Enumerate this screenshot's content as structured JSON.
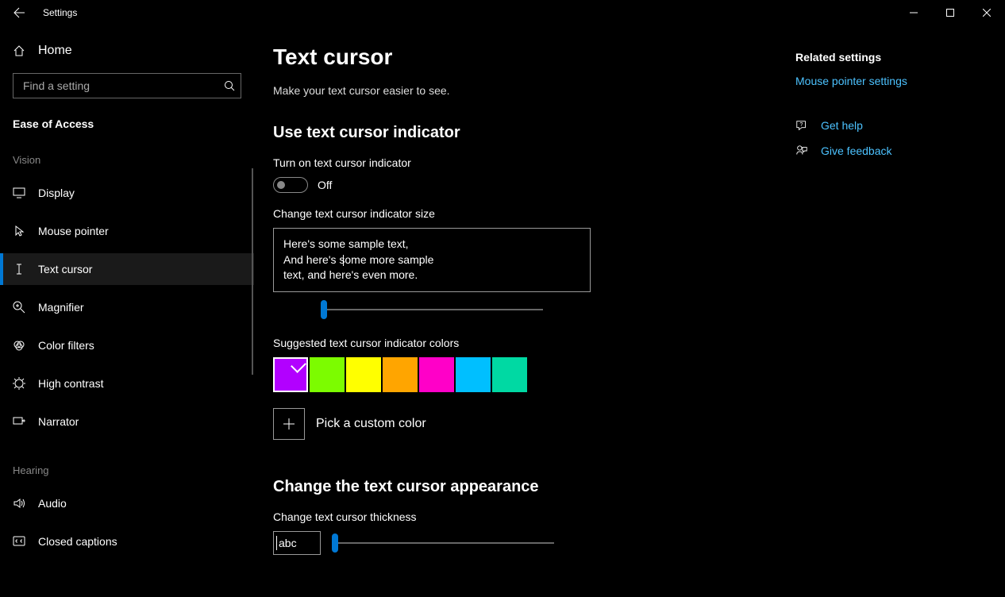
{
  "window": {
    "title": "Settings"
  },
  "sidebar": {
    "home": "Home",
    "search_placeholder": "Find a setting",
    "category": "Ease of Access",
    "groups": [
      {
        "label": "Vision",
        "items": [
          {
            "id": "display",
            "label": "Display"
          },
          {
            "id": "mouse-pointer",
            "label": "Mouse pointer"
          },
          {
            "id": "text-cursor",
            "label": "Text cursor",
            "active": true
          },
          {
            "id": "magnifier",
            "label": "Magnifier"
          },
          {
            "id": "color-filters",
            "label": "Color filters"
          },
          {
            "id": "high-contrast",
            "label": "High contrast"
          },
          {
            "id": "narrator",
            "label": "Narrator"
          }
        ]
      },
      {
        "label": "Hearing",
        "items": [
          {
            "id": "audio",
            "label": "Audio"
          },
          {
            "id": "closed-captions",
            "label": "Closed captions"
          }
        ]
      }
    ]
  },
  "page": {
    "title": "Text cursor",
    "subtitle": "Make your text cursor easier to see.",
    "section1_heading": "Use text cursor indicator",
    "toggle_label": "Turn on text cursor indicator",
    "toggle_state": "Off",
    "size_label": "Change text cursor indicator size",
    "sample_line1": "Here's some sample text,",
    "sample_line2": "And here's some more sample",
    "sample_line3": "text, and here's even more.",
    "colors_label": "Suggested text cursor indicator colors",
    "colors": [
      "#b200ff",
      "#7cfc00",
      "#ffff00",
      "#ffa500",
      "#ff00c8",
      "#00bfff",
      "#00d9a3"
    ],
    "selected_color_index": 0,
    "custom_color_label": "Pick a custom color",
    "section2_heading": "Change the text cursor appearance",
    "thickness_label": "Change text cursor thickness",
    "thickness_preview": "abc"
  },
  "related": {
    "heading": "Related settings",
    "link": "Mouse pointer settings",
    "help": "Get help",
    "feedback": "Give feedback"
  }
}
